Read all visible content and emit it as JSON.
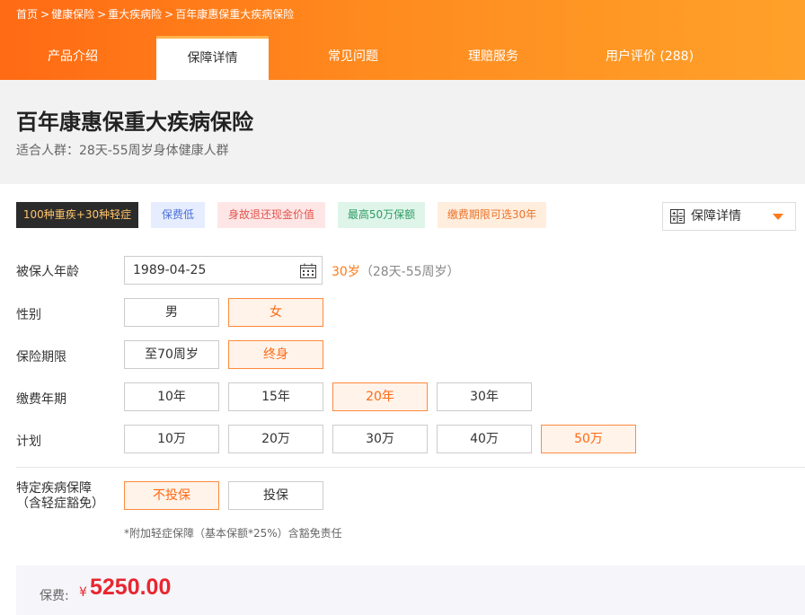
{
  "breadcrumb": [
    {
      "label": "首页"
    },
    {
      "label": "健康保险"
    },
    {
      "label": "重大疾病险"
    },
    {
      "label": "百年康惠保重大疾病保险"
    }
  ],
  "breadcrumb_separator": ">",
  "tabs": [
    {
      "label": "产品介绍",
      "active": false
    },
    {
      "label": "保障详情",
      "active": true
    },
    {
      "label": "常见问题",
      "active": false
    },
    {
      "label": "理赔服务",
      "active": false
    },
    {
      "label": "用户评价 (288)",
      "active": false
    }
  ],
  "product": {
    "title": "百年康惠保重大疾病保险",
    "subtitle": "适合人群：28天-55周岁身体健康人群"
  },
  "tags": [
    {
      "label": "100种重疾+30种轻症",
      "bg": "#2b2b2b",
      "color": "#ffc46b"
    },
    {
      "label": "保费低",
      "bg": "#e6edff",
      "color": "#4a6fd8"
    },
    {
      "label": "身故退还现金价值",
      "bg": "#ffe6e6",
      "color": "#e0554d"
    },
    {
      "label": "最高50万保额",
      "bg": "#dff5ea",
      "color": "#2f9c63"
    },
    {
      "label": "缴费期限可选30年",
      "bg": "#ffeede",
      "color": "#ec7228"
    }
  ],
  "view_dropdown": {
    "selected": "保障详情",
    "icon": "calculator-icon"
  },
  "form": {
    "age": {
      "label": "被保人年龄",
      "value": "1989-04-25",
      "age_text": "30岁",
      "range_text": "（28天-55周岁）"
    },
    "gender": {
      "label": "性别",
      "options": [
        "男",
        "女"
      ],
      "selected": 1
    },
    "term": {
      "label": "保险期限",
      "options": [
        "至70周岁",
        "终身"
      ],
      "selected": 1
    },
    "payment": {
      "label": "缴费年期",
      "options": [
        "10年",
        "15年",
        "20年",
        "30年"
      ],
      "selected": 2
    },
    "plan": {
      "label": "计划",
      "options": [
        "10万",
        "20万",
        "30万",
        "40万",
        "50万"
      ],
      "selected": 4
    },
    "special": {
      "label_line1": "特定疾病保障",
      "label_line2": "（含轻症豁免）",
      "options": [
        "不投保",
        "投保"
      ],
      "selected": 0
    },
    "footnote": "*附加轻症保障（基本保额*25%）含豁免责任"
  },
  "premium": {
    "label": "保费:",
    "currency": "¥",
    "value": "5250.00"
  },
  "colors": {
    "accent": "#ff6a14",
    "price": "#e8262f"
  }
}
